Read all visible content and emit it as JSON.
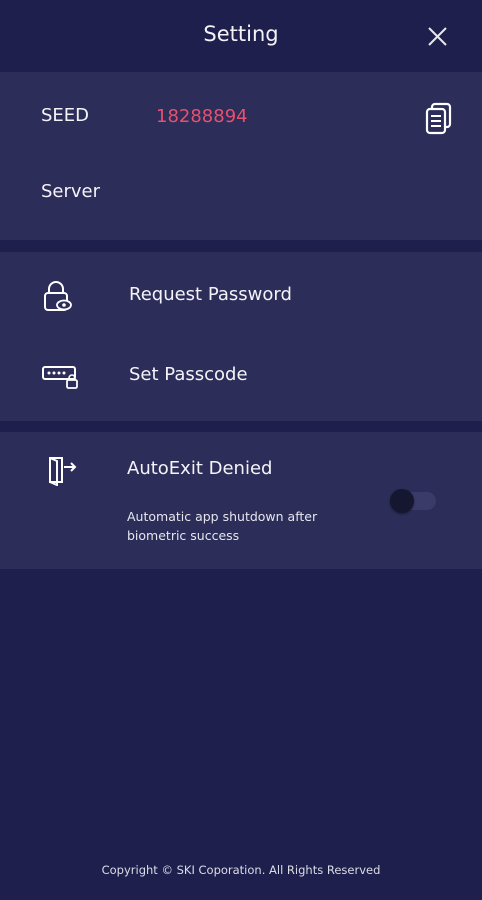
{
  "header": {
    "title": "Setting",
    "close_icon": "close-icon"
  },
  "seed_panel": {
    "seed_label": "SEED",
    "seed_value": "18288894",
    "seed_value_color": "#e8506e",
    "copy_icon": "copy-icon",
    "server_label": "Server"
  },
  "menu": {
    "items": [
      {
        "label": "Request Password",
        "icon": "lock-eye-icon"
      },
      {
        "label": "Set Passcode",
        "icon": "passcode-keyboard-icon"
      }
    ]
  },
  "auto_exit": {
    "title": "AutoExit Denied",
    "description": "Automatic app shutdown after biometric success",
    "icon": "exit-door-icon",
    "toggle_on": false
  },
  "footer": {
    "copyright": "Copyright © SKI Coporation. All Rights Reserved"
  },
  "colors": {
    "background": "#1e1f4d",
    "panel": "#2c2d59",
    "accent": "#e8506e"
  }
}
